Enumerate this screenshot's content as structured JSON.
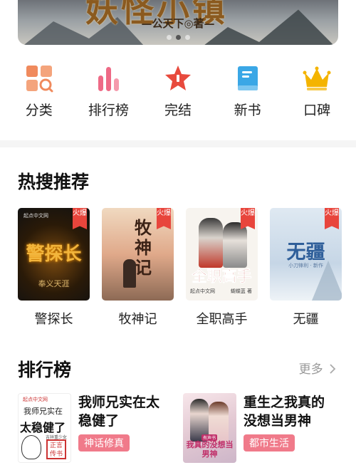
{
  "banner": {
    "title_art": "妖怪小镇",
    "author": "—公天下◎著—",
    "slide_count": 3,
    "active_slide": 2
  },
  "categories": [
    {
      "label": "分类",
      "icon": "category-grid-icon",
      "color": "#f08a5d"
    },
    {
      "label": "排行榜",
      "icon": "bar-chart-icon",
      "color": "#ee6a86"
    },
    {
      "label": "完结",
      "icon": "star-badge-icon",
      "color": "#e84a3d"
    },
    {
      "label": "新书",
      "icon": "book-icon",
      "color": "#3aa7e6"
    },
    {
      "label": "口碑",
      "icon": "crown-icon",
      "color": "#f4b400"
    }
  ],
  "hot_search": {
    "title": "热搜推荐",
    "books": [
      {
        "name": "警探长",
        "badge": "火爆",
        "cover_title": "警探长",
        "cover_author": "奉义天涯",
        "publisher": "起点中文网"
      },
      {
        "name": "牧神记",
        "badge": "火爆",
        "cover_title": "牧神记"
      },
      {
        "name": "全职高手",
        "badge": "火爆",
        "cover_title": "全职高手",
        "publisher": "起点中文网",
        "cover_author": "蝴蝶蓝 著"
      },
      {
        "name": "无疆",
        "badge": "火爆",
        "cover_title": "无疆",
        "cover_subtitle": "小刀锋利 · 新作"
      }
    ]
  },
  "ranking": {
    "title": "排行榜",
    "more_label": "更多",
    "items": [
      {
        "title": "我师兄实在太稳健了",
        "tag": "神话修真",
        "cover": {
          "publisher": "起点中文网",
          "line1": "我师兄实在",
          "line2": "太稳健了",
          "mini": "吉祥重少女",
          "seal": "正言传书"
        }
      },
      {
        "title": "重生之我真的没想当男神",
        "tag": "都市生活",
        "cover": {
          "badge": "有声书",
          "line": "我真的没想当男神"
        }
      }
    ]
  }
}
